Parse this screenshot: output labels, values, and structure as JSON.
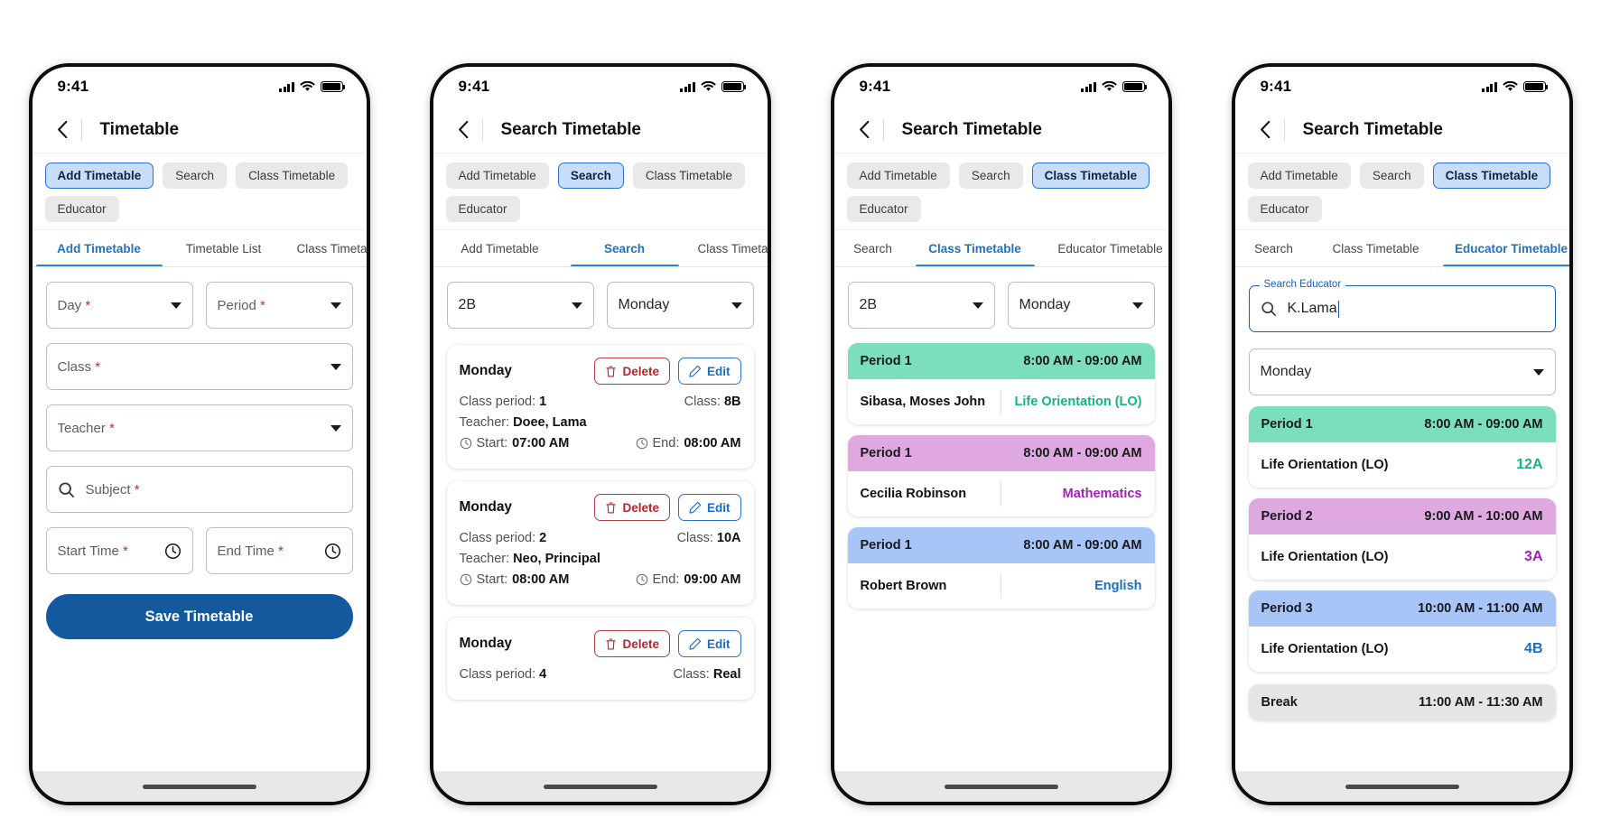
{
  "shared": {
    "status": {
      "time": "9:41",
      "signal_icon": "signal-bars-icon",
      "wifi_icon": "wifi-icon",
      "battery_icon": "battery-icon"
    },
    "back_icon": "chevron-left-icon",
    "chips": [
      "Add Timetable",
      "Search",
      "Class Timetable",
      "Educator"
    ],
    "colors": {
      "accent_blue": "#1d72c4",
      "primary_button": "#14589e",
      "chip_active_bg": "#c8ddfa",
      "chip_active_border": "#2b6fd1",
      "delete_red": "#b5262e",
      "edit_blue": "#1b6ec6",
      "period_green": "#7bdfbe",
      "period_pink": "#dfa8e0",
      "period_blue": "#a8c5f7",
      "subject_green": "#14b584",
      "subject_purple": "#a31fb5",
      "subject_blue": "#1a6fc4"
    }
  },
  "phones": [
    {
      "id": "phone-add-timetable",
      "title": "Timetable",
      "active_chip": "Add Timetable",
      "tabs": [
        {
          "label": "Add Timetable",
          "active": true
        },
        {
          "label": "Timetable List",
          "active": false
        },
        {
          "label": "Class Timetable",
          "active": false
        }
      ],
      "form": {
        "fields": [
          {
            "name": "day",
            "label": "Day",
            "required": true,
            "control": "dropdown",
            "width": "half"
          },
          {
            "name": "period",
            "label": "Period",
            "required": true,
            "control": "dropdown",
            "width": "half"
          },
          {
            "name": "class",
            "label": "Class",
            "required": true,
            "control": "dropdown",
            "width": "full"
          },
          {
            "name": "teacher",
            "label": "Teacher",
            "required": true,
            "control": "dropdown",
            "width": "full"
          },
          {
            "name": "subject",
            "label": "Subject",
            "required": true,
            "control": "search",
            "width": "full"
          },
          {
            "name": "start-time",
            "label": "Start Time",
            "required": true,
            "control": "clock",
            "width": "half"
          },
          {
            "name": "end-time",
            "label": "End Time",
            "required": true,
            "control": "clock",
            "width": "half"
          }
        ],
        "save_label": "Save Timetable"
      }
    },
    {
      "id": "phone-search",
      "title": "Search Timetable",
      "active_chip": "Search",
      "tabs": [
        {
          "label": "Add Timetable",
          "active": false
        },
        {
          "label": "Search",
          "active": true
        },
        {
          "label": "Class Timetable",
          "active": false
        }
      ],
      "filters": {
        "class_value": "2B",
        "day_value": "Monday"
      },
      "labels": {
        "day": "Monday",
        "delete": "Delete",
        "edit": "Edit",
        "class_period": "Class period:",
        "class": "Class:",
        "teacher": "Teacher:",
        "start": "Start:",
        "end": "End:"
      },
      "results": [
        {
          "day": "Monday",
          "class_period": "1",
          "class": "8B",
          "teacher": "Doee, Lama",
          "start": "07:00 AM",
          "end": "08:00 AM"
        },
        {
          "day": "Monday",
          "class_period": "2",
          "class": "10A",
          "teacher": "Neo, Principal",
          "start": "08:00 AM",
          "end": "09:00 AM"
        },
        {
          "day": "Monday",
          "class_period": "4",
          "class": "Real",
          "teacher": "",
          "start": "",
          "end": ""
        }
      ]
    },
    {
      "id": "phone-class-timetable",
      "title": "Search Timetable",
      "active_chip": "Class Timetable",
      "tabs": [
        {
          "label": "Search",
          "active": false
        },
        {
          "label": "Class Timetable",
          "active": true
        },
        {
          "label": "Educator Timetable",
          "active": false
        }
      ],
      "filters": {
        "class_value": "2B",
        "day_value": "Monday"
      },
      "periods": [
        {
          "period": "Period 1",
          "time": "8:00 AM - 09:00 AM",
          "teacher": "Sibasa, Moses John",
          "subject": "Life Orientation (LO)",
          "header_color": "#7bdfbe",
          "subject_color": "#14b584"
        },
        {
          "period": "Period 1",
          "time": "8:00 AM - 09:00 AM",
          "teacher": "Cecilia Robinson",
          "subject": "Mathematics",
          "header_color": "#dfa8e0",
          "subject_color": "#a31fb5"
        },
        {
          "period": "Period 1",
          "time": "8:00 AM - 09:00 AM",
          "teacher": "Robert Brown",
          "subject": "English",
          "header_color": "#a8c5f7",
          "subject_color": "#1a6fc4"
        }
      ]
    },
    {
      "id": "phone-educator-timetable",
      "title": "Search Timetable",
      "active_chip": "Class Timetable",
      "tabs": [
        {
          "label": "Search",
          "active": false
        },
        {
          "label": "Class Timetable",
          "active": false
        },
        {
          "label": "Educator Timetable",
          "active": true
        }
      ],
      "search": {
        "legend": "Search Educator",
        "value": "K.Lama",
        "icon": "search-icon"
      },
      "day_value": "Monday",
      "periods": [
        {
          "period": "Period 1",
          "time": "8:00 AM - 09:00 AM",
          "subject": "Life Orientation (LO)",
          "class": "12A",
          "header_color": "#7bdfbe",
          "class_color": "#14b584"
        },
        {
          "period": "Period 2",
          "time": "9:00 AM - 10:00 AM",
          "subject": "Life Orientation (LO)",
          "class": "3A",
          "header_color": "#dfa8e0",
          "class_color": "#a31fb5"
        },
        {
          "period": "Period 3",
          "time": "10:00 AM - 11:00 AM",
          "subject": "Life Orientation (LO)",
          "class": "4B",
          "header_color": "#a8c5f7",
          "class_color": "#1a6fc4"
        },
        {
          "period": "Break",
          "time": "11:00 AM - 11:30 AM",
          "subject": "",
          "class": "",
          "header_color": "#e5e5e5",
          "class_color": "#555555"
        }
      ]
    }
  ]
}
